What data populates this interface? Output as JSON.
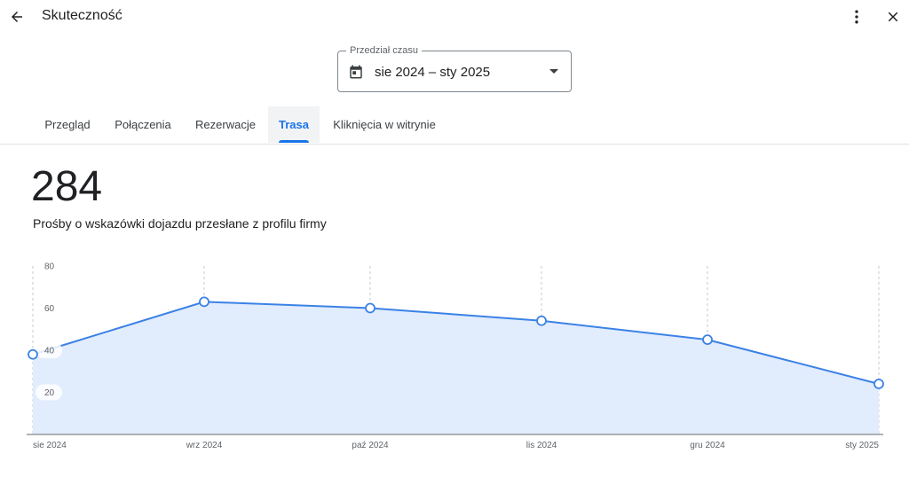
{
  "header": {
    "title": "Skuteczność",
    "icons": {
      "back": "arrow-back-icon",
      "more": "more-vert-icon",
      "close": "close-icon"
    }
  },
  "date_range": {
    "label": "Przedział czasu",
    "value": "sie 2024 – sty 2025",
    "icons": {
      "calendar": "calendar-icon",
      "caret": "dropdown-caret-icon"
    }
  },
  "tabs": [
    {
      "label": "Przegląd",
      "active": false
    },
    {
      "label": "Połączenia",
      "active": false
    },
    {
      "label": "Rezerwacje",
      "active": false
    },
    {
      "label": "Trasa",
      "active": true
    },
    {
      "label": "Kliknięcia w witrynie",
      "active": false
    }
  ],
  "metric": {
    "value": "284",
    "description": "Prośby o wskazówki dojazdu przesłane z profilu firmy"
  },
  "colors": {
    "accent": "#1a73e8",
    "line": "#3b82e6",
    "area": "#e1ecfd"
  },
  "chart_data": {
    "type": "area",
    "x": [
      "sie 2024",
      "wrz 2024",
      "paź 2024",
      "lis 2024",
      "gru 2024",
      "sty 2025"
    ],
    "values": [
      38,
      63,
      60,
      54,
      45,
      24
    ],
    "y_ticks": [
      "80",
      "60",
      "40",
      "20"
    ],
    "ylim": [
      0,
      80
    ],
    "grid": true
  }
}
